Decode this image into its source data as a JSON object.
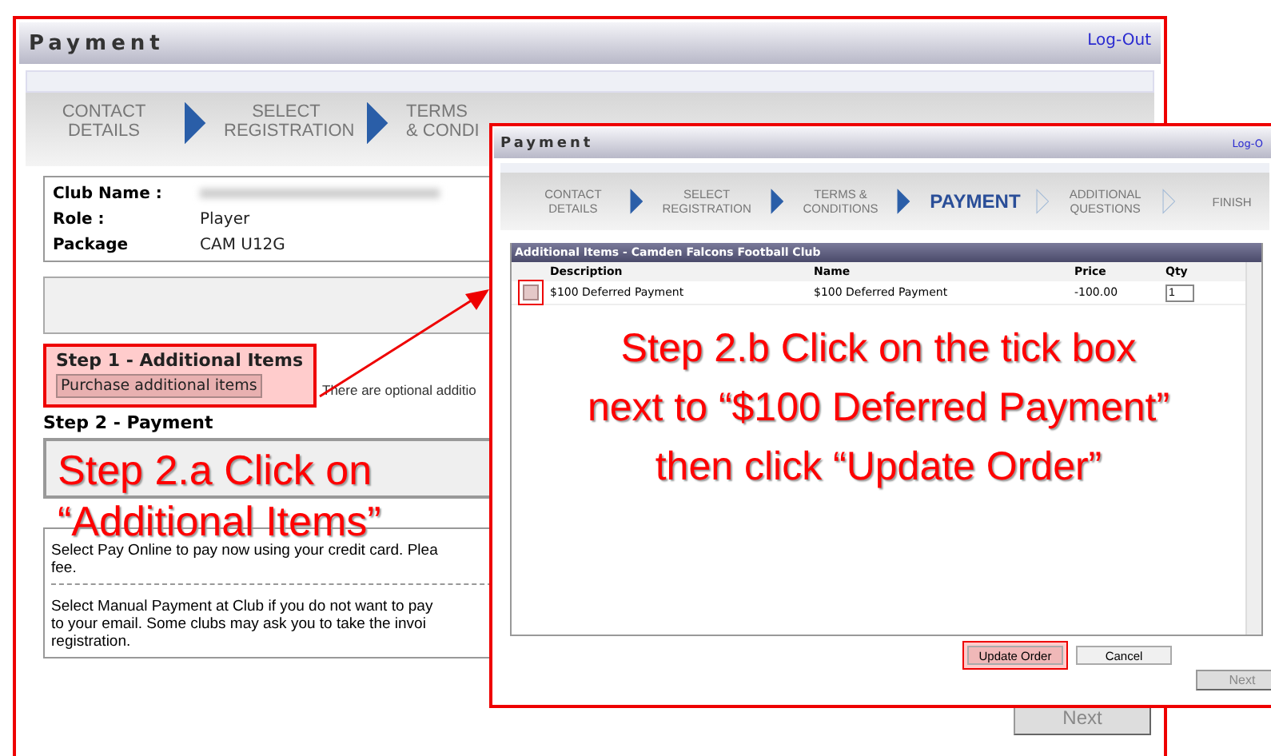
{
  "main_window": {
    "title": "Payment",
    "logout": "Log-Out",
    "steps": [
      {
        "label": "CONTACT DETAILS"
      },
      {
        "label": "SELECT REGISTRATION"
      },
      {
        "label": "TERMS & CONDI"
      }
    ],
    "step_arrows": [
      {
        "filled": true
      },
      {
        "filled": true
      }
    ],
    "info": [
      {
        "label": "Club Name :"
      },
      {
        "label": "Role :",
        "value": "Player"
      },
      {
        "label": "Package",
        "value": "CAM U12G"
      }
    ],
    "step1": {
      "heading": "Step 1 - Additional Items",
      "button": "Purchase additional items",
      "note": "There are optional additio",
      "highlighted": true
    },
    "step2": {
      "heading": "Step 2 - Payment",
      "paragraphs": [
        "Select Pay Online to pay now using your credit card. Plea\nfee.",
        "Select Manual Payment at Club if you do not want to pay\nto your email. Some clubs may ask you to take the invoi\nregistration."
      ]
    },
    "next": "Next"
  },
  "dialog_window": {
    "title": "Payment",
    "logout": "Log-O",
    "steps": [
      {
        "label": "CONTACT DETAILS",
        "current": false
      },
      {
        "label": "SELECT REGISTRATION",
        "current": false
      },
      {
        "label": "TERMS & CONDITIONS",
        "current": false
      },
      {
        "label": "PAYMENT",
        "current": true
      },
      {
        "label": "ADDITIONAL QUESTIONS",
        "current": false
      },
      {
        "label": "FINISH",
        "current": false
      }
    ],
    "step_arrows": [
      {
        "filled": true
      },
      {
        "filled": true
      },
      {
        "filled": true
      },
      {
        "filled": false
      },
      {
        "filled": false
      }
    ],
    "table": {
      "title": "Additional Items - Camden Falcons Football Club",
      "columns": [
        "Description",
        "Name",
        "Price",
        "Qty"
      ],
      "rows": [
        {
          "checked": false,
          "highlighted": true,
          "description": "$100 Deferred Payment",
          "name": "$100 Deferred Payment",
          "price": "-100.00",
          "qty": "1"
        }
      ]
    },
    "buttons": [
      {
        "label": "Update Order",
        "highlighted": true
      },
      {
        "label": "Cancel",
        "highlighted": false
      }
    ],
    "next": "Next"
  },
  "annotations": [
    {
      "text": "Step 2.a Click on\n“Additional Items”"
    },
    {
      "text": "Step 2.b Click on the tick box\nnext to “$100 Deferred Payment”\nthen click “Update Order”"
    }
  ]
}
